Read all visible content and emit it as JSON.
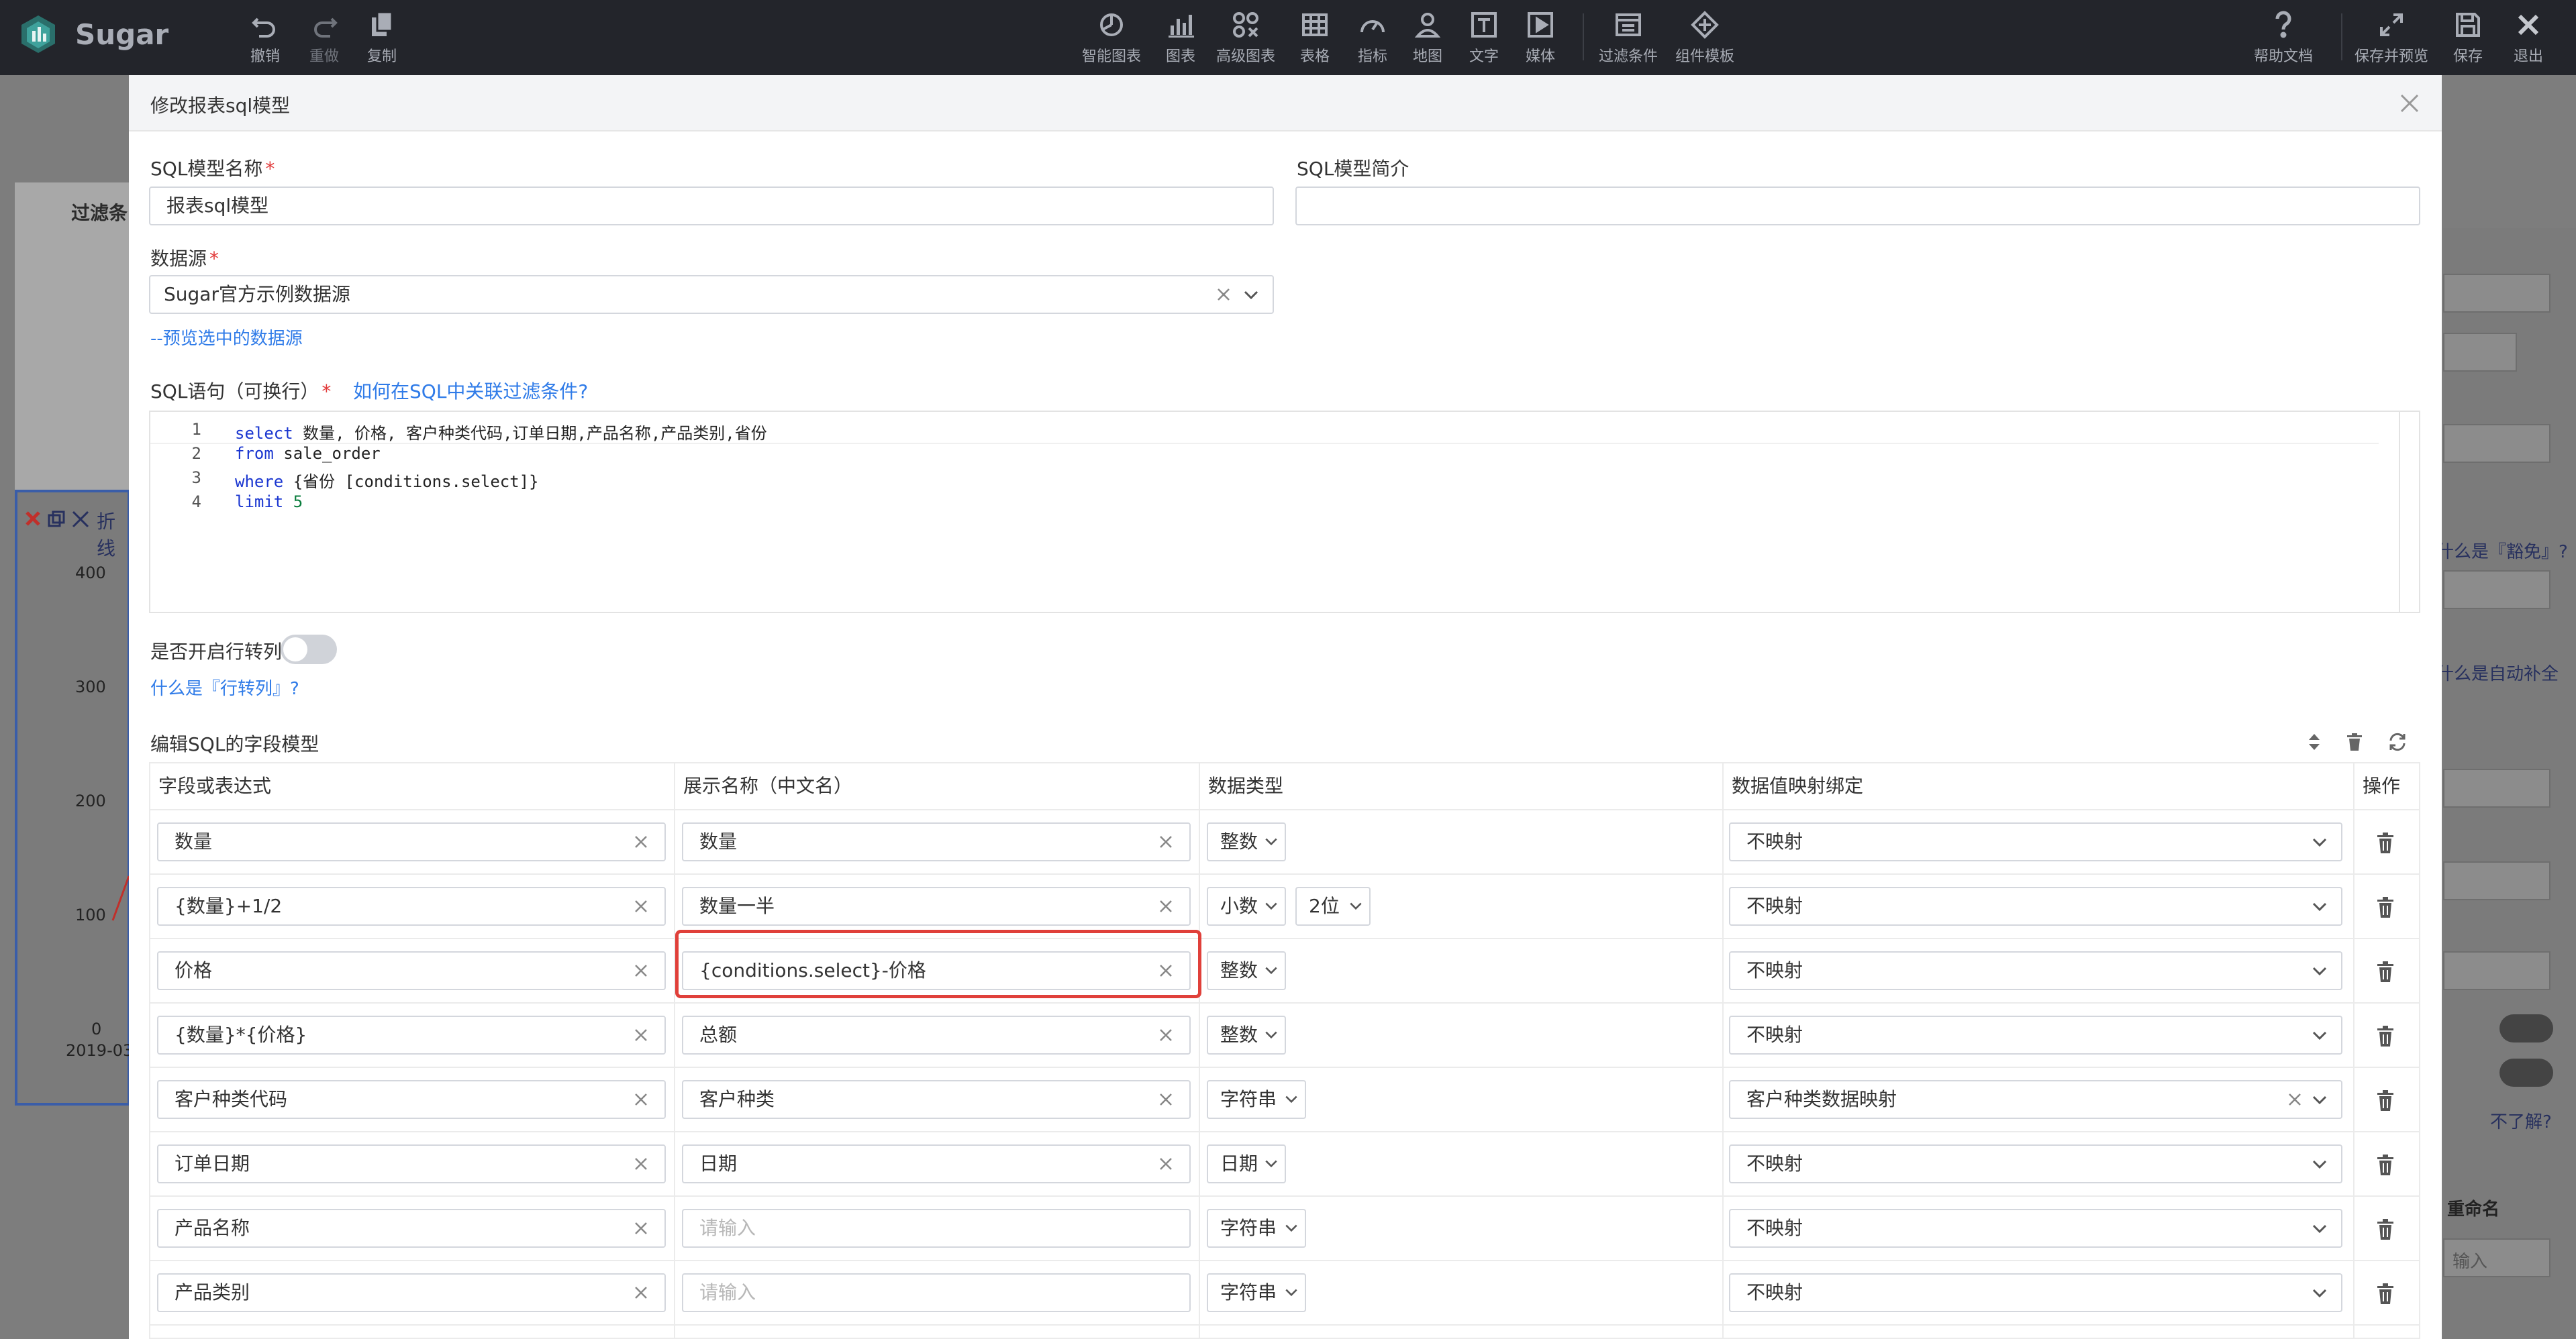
{
  "app": {
    "name": "Sugar",
    "toolbar_left": [
      {
        "id": "undo",
        "label": "撤销",
        "icon": "undo-icon"
      },
      {
        "id": "redo",
        "label": "重做",
        "icon": "redo-icon"
      },
      {
        "id": "copy",
        "label": "复制",
        "icon": "copy-icon"
      }
    ],
    "toolbar_center": [
      {
        "id": "smart-chart",
        "label": "智能图表",
        "icon": "smart-chart-icon"
      },
      {
        "id": "chart",
        "label": "图表",
        "icon": "bar-chart-icon"
      },
      {
        "id": "adv-chart",
        "label": "高级图表",
        "icon": "advanced-chart-icon"
      },
      {
        "id": "table",
        "label": "表格",
        "icon": "table-icon"
      },
      {
        "id": "metric",
        "label": "指标",
        "icon": "gauge-icon"
      },
      {
        "id": "map",
        "label": "地图",
        "icon": "map-pin-icon"
      },
      {
        "id": "text",
        "label": "文字",
        "icon": "text-icon"
      },
      {
        "id": "media",
        "label": "媒体",
        "icon": "media-icon"
      },
      {
        "id": "filter",
        "label": "过滤条件",
        "icon": "filter-icon"
      },
      {
        "id": "template",
        "label": "组件模板",
        "icon": "template-icon"
      }
    ],
    "toolbar_right": [
      {
        "id": "help",
        "label": "帮助文档",
        "icon": "help-icon"
      },
      {
        "id": "save-preview",
        "label": "保存并预览",
        "icon": "expand-icon"
      },
      {
        "id": "save",
        "label": "保存",
        "icon": "save-icon"
      },
      {
        "id": "exit",
        "label": "退出",
        "icon": "close-icon"
      }
    ]
  },
  "background": {
    "left_label": "过滤条",
    "chart_title": "折线",
    "y_ticks": [
      "400",
      "300",
      "200",
      "100",
      "0"
    ],
    "x_tick": "2019-03",
    "right_text_1": "什么是『豁免』?",
    "right_text_2": "什么是自动补全",
    "right_text_3": "不了解?",
    "right_text_4": "重命名",
    "right_text_5": "输入"
  },
  "modal": {
    "title": "修改报表sql模型",
    "sql_name": {
      "label": "SQL模型名称",
      "value": "报表sql模型"
    },
    "sql_desc": {
      "label": "SQL模型简介",
      "value": ""
    },
    "datasource": {
      "label": "数据源",
      "value": "Sugar官方示例数据源",
      "preview_link": "--预览选中的数据源"
    },
    "sql": {
      "label": "SQL语句（可换行）",
      "help_link": "如何在SQL中关联过滤条件?",
      "lines": [
        {
          "no": "1",
          "kw": "select",
          "rest": " 数量, 价格, 客户种类代码,订单日期,产品名称,产品类别,省份"
        },
        {
          "no": "2",
          "kw": "from",
          "rest": " sale_order"
        },
        {
          "no": "3",
          "kw": "where",
          "rest": " {省份 [conditions.select]}"
        },
        {
          "no": "4",
          "kw": "limit",
          "rest": " ",
          "num": "5"
        }
      ]
    },
    "row_to_col": {
      "label": "是否开启行转列",
      "help_link": "什么是『行转列』?"
    },
    "fields": {
      "title": "编辑SQL的字段模型",
      "columns": [
        "字段或表达式",
        "展示名称（中文名）",
        "数据类型",
        "数据值映射绑定",
        "操作"
      ],
      "placeholder": "请输入",
      "rows": [
        {
          "expr": "数量",
          "display": "数量",
          "type": "整数",
          "decimals": "",
          "mapping": "不映射"
        },
        {
          "expr": "{数量}+1/2",
          "display": "数量一半",
          "type": "小数",
          "decimals": "2位",
          "mapping": "不映射"
        },
        {
          "expr": "价格",
          "display": "{conditions.select}-价格",
          "type": "整数",
          "decimals": "",
          "mapping": "不映射"
        },
        {
          "expr": "{数量}*{价格}",
          "display": "总额",
          "type": "整数",
          "decimals": "",
          "mapping": "不映射"
        },
        {
          "expr": "客户种类代码",
          "display": "客户种类",
          "type": "字符串",
          "decimals": "",
          "mapping": "客户种类数据映射"
        },
        {
          "expr": "订单日期",
          "display": "日期",
          "type": "日期",
          "decimals": "",
          "mapping": "不映射"
        },
        {
          "expr": "产品名称",
          "display": "",
          "type": "字符串",
          "decimals": "",
          "mapping": "不映射"
        },
        {
          "expr": "产品类别",
          "display": "",
          "type": "字符串",
          "decimals": "",
          "mapping": "不映射"
        }
      ]
    }
  }
}
